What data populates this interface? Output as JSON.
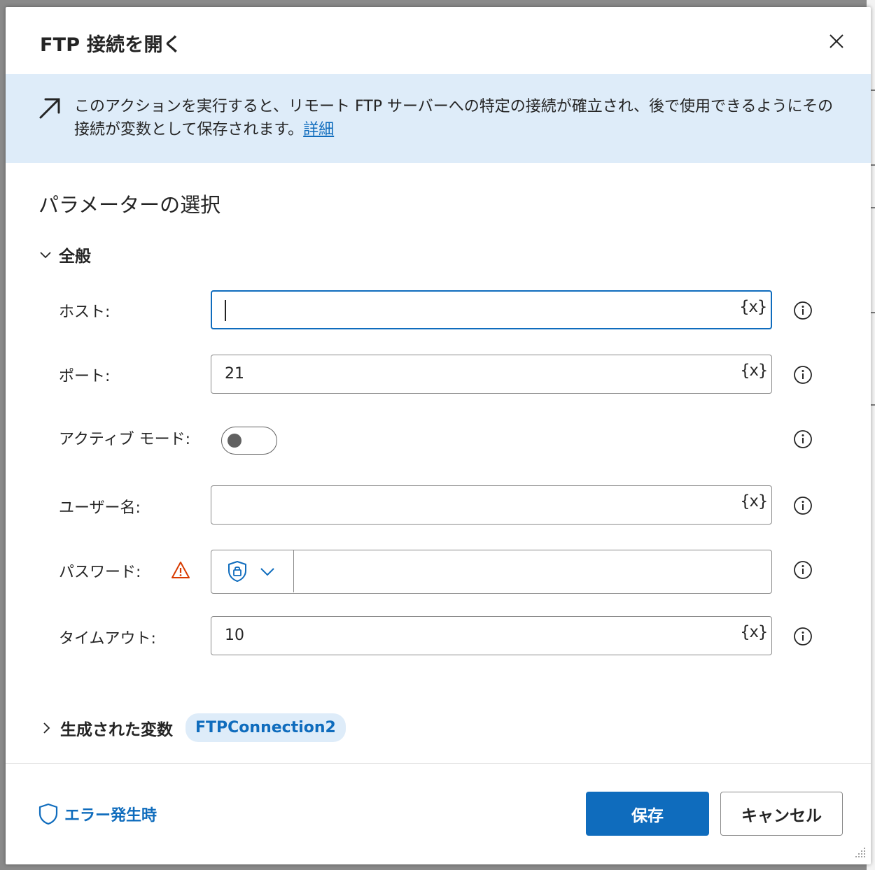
{
  "dialog": {
    "title": "FTP 接続を開く",
    "close_icon": "close-icon"
  },
  "info": {
    "icon": "arrow-up-right-icon",
    "text": "このアクションを実行すると、リモート FTP サーバーへの特定の接続が確立され、後で使用できるようにその接続が変数として保存されます。",
    "link_label": "詳細"
  },
  "section_title": "パラメーターの選択",
  "general": {
    "label": "全般",
    "expanded": true,
    "fields": {
      "host": {
        "label": "ホスト:",
        "value": "",
        "focused": true,
        "var_label": "{x}"
      },
      "port": {
        "label": "ポート:",
        "value": "21",
        "var_label": "{x}"
      },
      "active_mode": {
        "label": "アクティブ モード:",
        "on": false
      },
      "username": {
        "label": "ユーザー名:",
        "value": "",
        "var_label": "{x}"
      },
      "password": {
        "label": "パスワード:",
        "value": "",
        "mode_icon": "shield-lock-icon",
        "warning_icon": "warning-icon"
      },
      "timeout": {
        "label": "タイムアウト:",
        "value": "10",
        "var_label": "{x}"
      }
    }
  },
  "generated_variables": {
    "label": "生成された変数",
    "expanded": false,
    "chip": "FTPConnection2"
  },
  "footer": {
    "on_error_label": "エラー発生時",
    "save_label": "保存",
    "cancel_label": "キャンセル"
  },
  "colors": {
    "accent": "#0f6cbd",
    "banner_bg": "#deecf9",
    "warning": "#d83b01"
  }
}
